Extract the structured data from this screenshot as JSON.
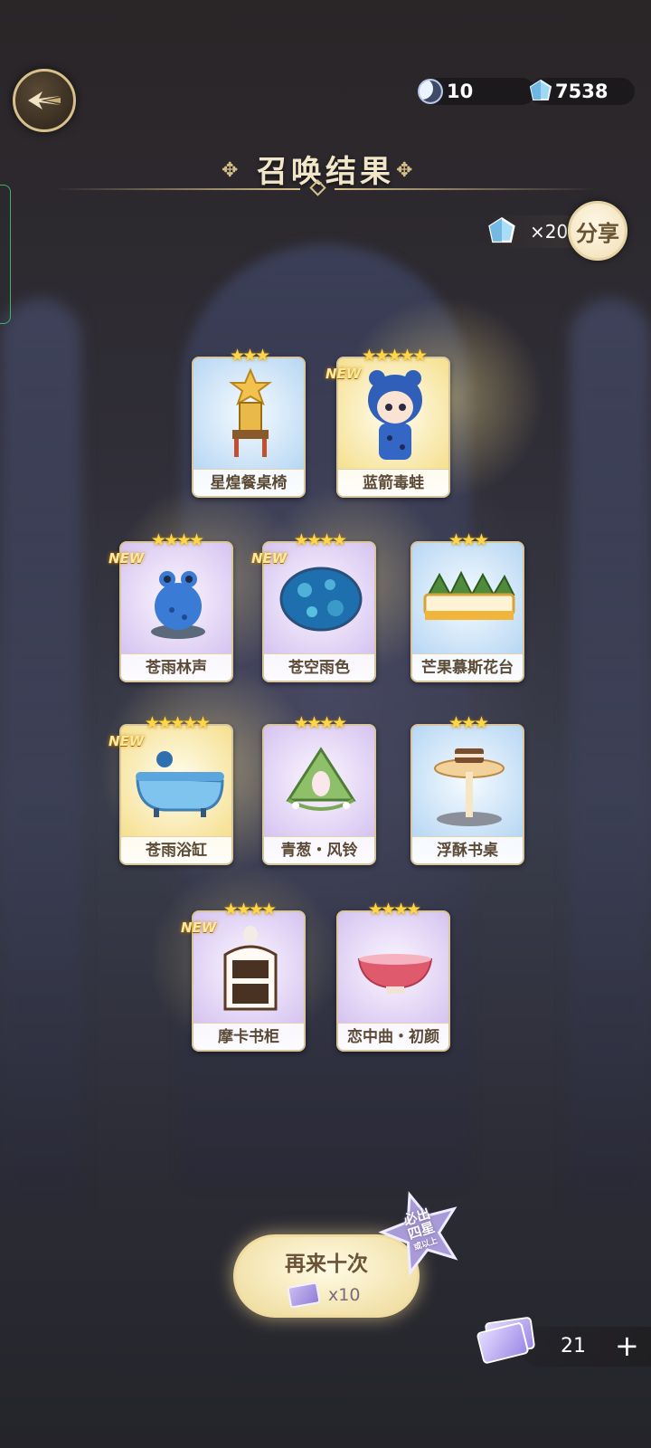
{
  "currency": {
    "moon_value": "10",
    "gem_value": "7538"
  },
  "header": {
    "title": "召唤结果"
  },
  "share": {
    "reward_count": "×20",
    "button_label": "分享"
  },
  "results": [
    {
      "name": "星煌餐桌椅",
      "stars": "★★★",
      "rarity": 3,
      "is_new": false,
      "icon": "star-chair-icon"
    },
    {
      "name": "蓝箭毒蛙",
      "stars": "★★★★★",
      "rarity": 5,
      "is_new": true,
      "icon": "character-frog-girl-icon"
    },
    {
      "name": "苍雨林声",
      "stars": "★★★★",
      "rarity": 4,
      "is_new": true,
      "icon": "blue-frog-statue-icon"
    },
    {
      "name": "苍空雨色",
      "stars": "★★★★",
      "rarity": 4,
      "is_new": true,
      "icon": "round-blue-rug-icon"
    },
    {
      "name": "芒果慕斯花台",
      "stars": "★★★",
      "rarity": 3,
      "is_new": false,
      "icon": "mango-mousse-planter-icon"
    },
    {
      "name": "苍雨浴缸",
      "stars": "★★★★★",
      "rarity": 5,
      "is_new": true,
      "icon": "blue-bathtub-icon"
    },
    {
      "name": "青葱・风铃",
      "stars": "★★★★",
      "rarity": 4,
      "is_new": false,
      "icon": "green-wind-chime-icon"
    },
    {
      "name": "浮酥书桌",
      "stars": "★★★",
      "rarity": 3,
      "is_new": false,
      "icon": "pastry-desk-icon"
    },
    {
      "name": "摩卡书柜",
      "stars": "★★★★",
      "rarity": 4,
      "is_new": true,
      "icon": "mocha-bookcase-icon"
    },
    {
      "name": "恋中曲・初颜",
      "stars": "★★★★",
      "rarity": 4,
      "is_new": false,
      "icon": "pink-bowl-icon"
    }
  ],
  "new_badge": "NEW",
  "summon_again": {
    "label": "再来十次",
    "cost": "x10"
  },
  "guarantee": {
    "line1": "必出",
    "line2": "四星",
    "line3": "或以上"
  },
  "tickets": {
    "count": "21",
    "plus": "+"
  },
  "colors": {
    "gold_accent": "#d6c08a",
    "rarity3_bg": "#b6d6f3",
    "rarity4_bg": "#d5c2f0",
    "rarity5_bg": "#f5df8d"
  }
}
